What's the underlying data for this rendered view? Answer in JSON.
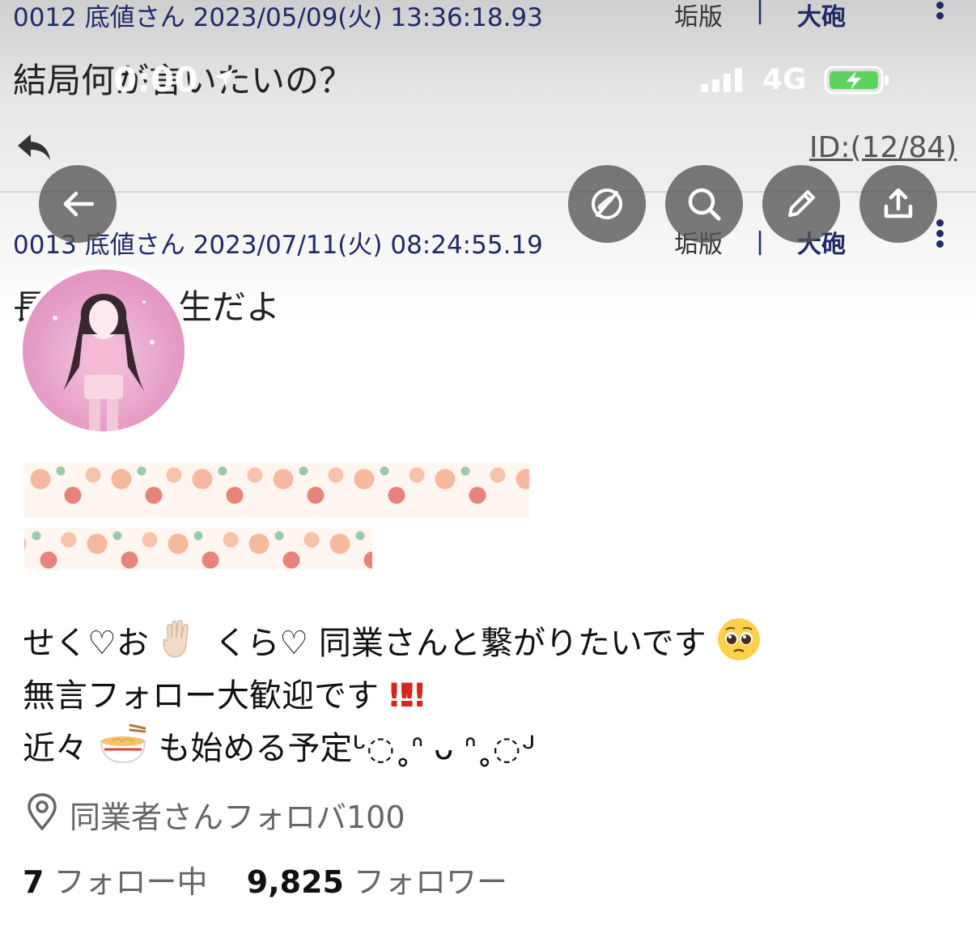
{
  "thread": {
    "post12": {
      "number": "0012",
      "author": "底値さん",
      "datetime": "2023/05/09(火) 13:36:18.93",
      "tag1": "垢版",
      "separator": "|",
      "tag2": "大砲",
      "body": "結局何が言いたいの？",
      "id_ref": "ID:(12/84)"
    },
    "post13": {
      "number": "0013",
      "author": "底値さん",
      "datetime": "2023/07/11(火) 08:24:55.19",
      "tag1": "垢版",
      "separator": "|",
      "tag2": "大砲",
      "body_start": "長",
      "body_end": "生だよ"
    }
  },
  "status_bar": {
    "time": "0:00",
    "network": "4G"
  },
  "overlay_buttons": [
    "back",
    "compass",
    "search",
    "edit",
    "share"
  ],
  "profile": {
    "bio_line1_a": "せく♡お",
    "bio_line1_b": "くら♡ 同業さんと繋がりたいです",
    "bio_line2_a": "無言フォロー大歓迎です",
    "bio_line2_b": "‼‼",
    "bio_line3_a": "近々",
    "bio_line3_b": "も始める予定ᒡ◌˳ᐢ ᴗ ᐢ˳◌ᒢ",
    "location": "同業者さんフォロバ100",
    "following_count": "7",
    "following_label": "フォロー中",
    "followers_count": "9,825",
    "followers_label": "フォロワー"
  },
  "colors": {
    "meta_text": "#1f2a66",
    "overlay_button": "#555555",
    "battery_green": "#5fd35f",
    "exclamation_red": "#d7261f"
  }
}
